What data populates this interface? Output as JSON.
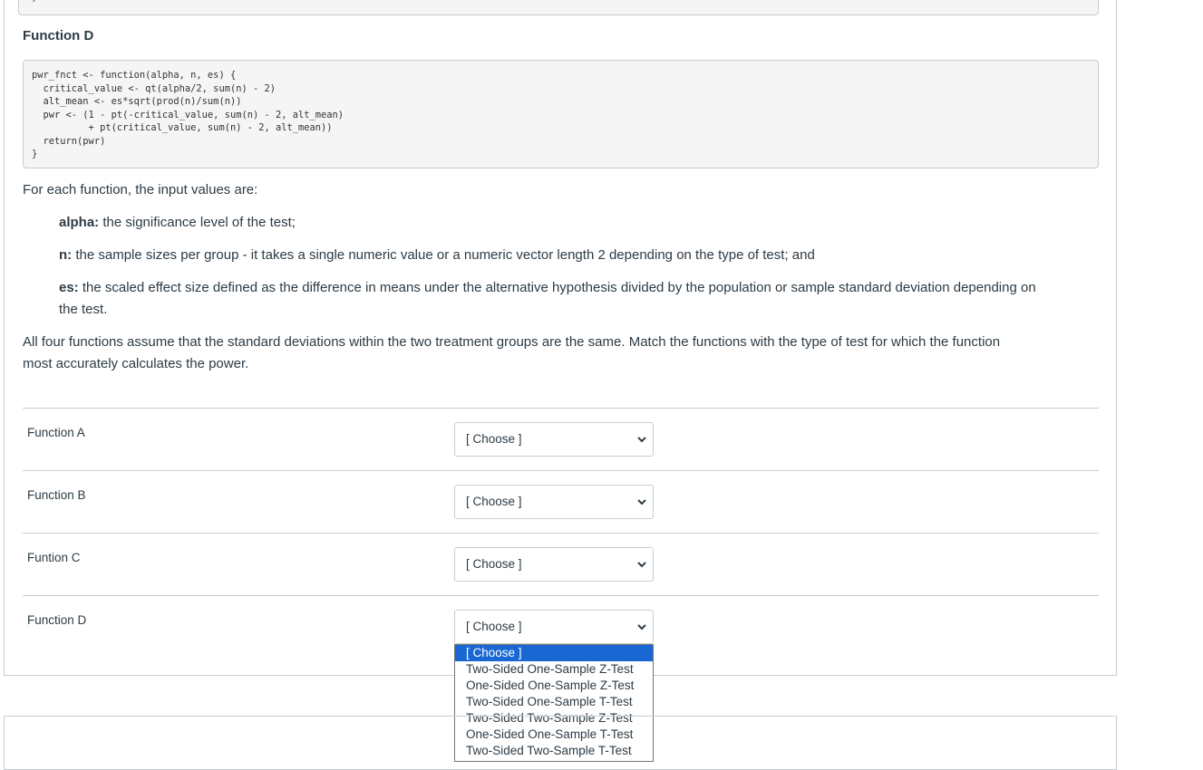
{
  "prev_code_tail": "}",
  "function_d": {
    "title": "Function D",
    "code": "pwr_fnct <- function(alpha, n, es) {\n  critical_value <- qt(alpha/2, sum(n) - 2)\n  alt_mean <- es*sqrt(prod(n)/sum(n))\n  pwr <- (1 - pt(-critical_value, sum(n) - 2, alt_mean)\n          + pt(critical_value, sum(n) - 2, alt_mean))\n  return(pwr)\n}"
  },
  "description": {
    "intro": "For each function, the input values are:",
    "alpha_term": "alpha:",
    "alpha_text": " the significance level of the test;",
    "n_term": "n:",
    "n_text": " the sample sizes per group - it takes a single numeric value or a numeric vector length 2 depending on the type of test; and",
    "es_term": "es:",
    "es_text_line1": " the scaled effect size defined as the difference in means under the alternative hypothesis divided by the population or sample standard deviation depending on",
    "es_text_line2": "the test.",
    "instructions_line1": "All four functions assume that the standard deviations within the two treatment groups are the same. Match the functions with the type of test for which the function",
    "instructions_line2": "most accurately calculates the power."
  },
  "matching": [
    {
      "label": "Function A",
      "selected": "[ Choose ]"
    },
    {
      "label": "Function B",
      "selected": "[ Choose ]"
    },
    {
      "label": "Funtion C",
      "selected": "[ Choose ]"
    },
    {
      "label": "Function D",
      "selected": "[ Choose ]"
    }
  ],
  "dropdown_options": [
    "[ Choose ]",
    "Two-Sided One-Sample Z-Test",
    "One-Sided One-Sample Z-Test",
    "Two-Sided One-Sample T-Test",
    "Two-Sided Two-Sample Z-Test",
    "One-Sided One-Sample T-Test",
    "Two-Sided Two-Sample T-Test"
  ],
  "colors": {
    "text": "#2d3b45",
    "border": "#c7cdd1",
    "highlight": "#1967d2",
    "code_bg": "#f5f5f5"
  }
}
